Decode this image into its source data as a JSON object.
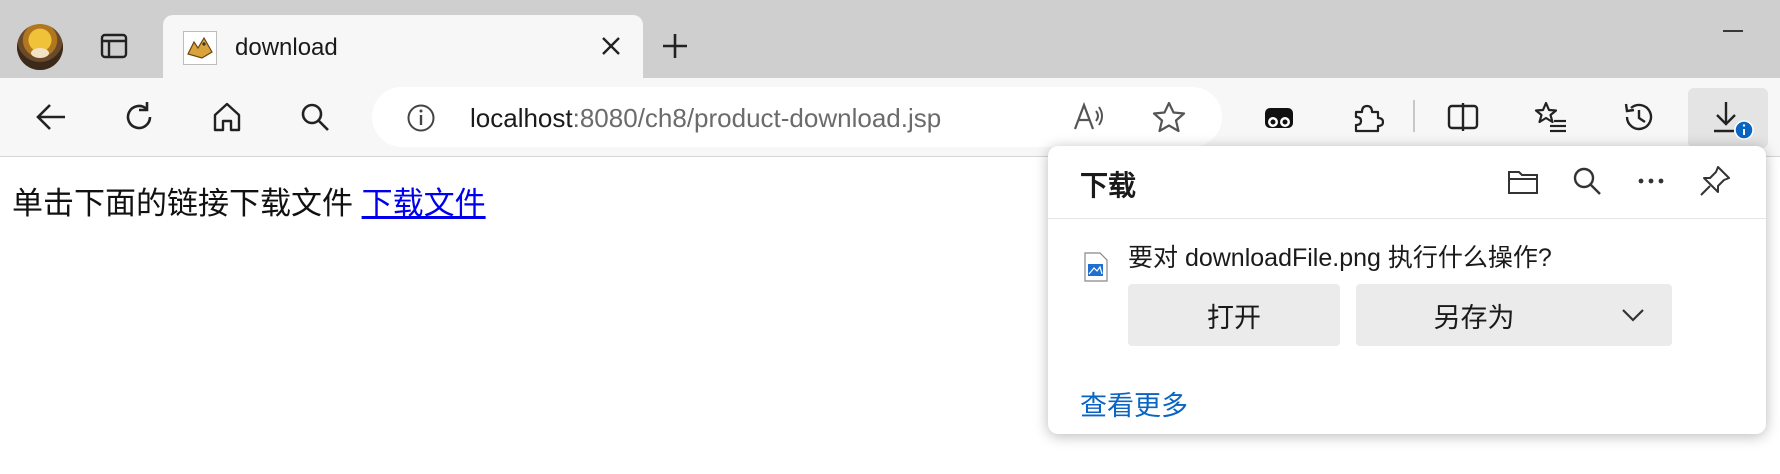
{
  "browser": {
    "tab": {
      "title": "download"
    },
    "address_bar": {
      "host": "localhost",
      "rest": ":8080/ch8/product-download.jsp"
    },
    "icons": {
      "back": "back-arrow-icon",
      "refresh": "refresh-icon",
      "home": "home-icon",
      "search": "search-icon",
      "info": "info-icon",
      "read_aloud": "read-aloud-icon",
      "favorite": "star-icon",
      "extension": "puzzle-icon",
      "split": "split-screen-icon",
      "favorites": "favorites-list-icon",
      "history": "history-icon",
      "downloads": "download-icon"
    }
  },
  "page": {
    "text": "单击下面的链接下载文件",
    "link": "下载文件"
  },
  "download_panel": {
    "title": "下载",
    "question": "要对 downloadFile.png 执行什么操作?",
    "open_label": "打开",
    "saveas_label": "另存为",
    "see_more": "查看更多"
  },
  "colors": {
    "link": "#0000ee",
    "see_more": "#0a64c2",
    "badge": "#0a64c2"
  }
}
